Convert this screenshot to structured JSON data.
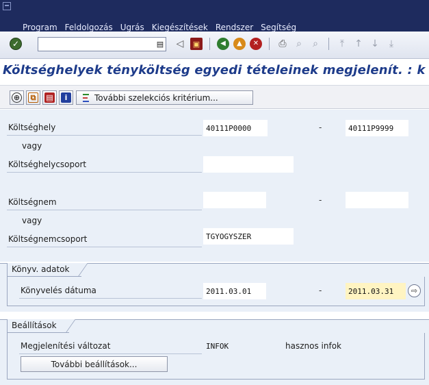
{
  "menu": [
    "Program",
    "Feldolgozás",
    "Ugrás",
    "Kiegészítések",
    "Rendszer",
    "Segítség"
  ],
  "toolbar": {
    "command_value": ""
  },
  "title": "Költséghelyek tényköltség egyedi tételeinek megjelenít. : k",
  "app_toolbar": {
    "more_criteria_label": "További szelekciós kritérium..."
  },
  "selection": {
    "cost_center": {
      "label": "Költséghely",
      "from": "40111P0000",
      "to": "40111P9999"
    },
    "or1": "vagy",
    "cost_center_group": {
      "label": "Költséghelycsoport",
      "value": ""
    },
    "cost_element": {
      "label": "Költségnem",
      "from": "",
      "to": ""
    },
    "or2": "vagy",
    "cost_element_group": {
      "label": "Költségnemcsoport",
      "value": "TGYOGYSZER"
    }
  },
  "posting_group": {
    "title": "Könyv. adatok",
    "posting_date": {
      "label": "Könyvelés dátuma",
      "from": "2011.03.01",
      "to": "2011.03.31"
    }
  },
  "settings_group": {
    "title": "Beállítások",
    "layout": {
      "label": "Megjelenítési változat",
      "value": "INFOK",
      "description": "hasznos infok"
    },
    "more_settings_label": "További beállítások..."
  },
  "range_separator": "-"
}
